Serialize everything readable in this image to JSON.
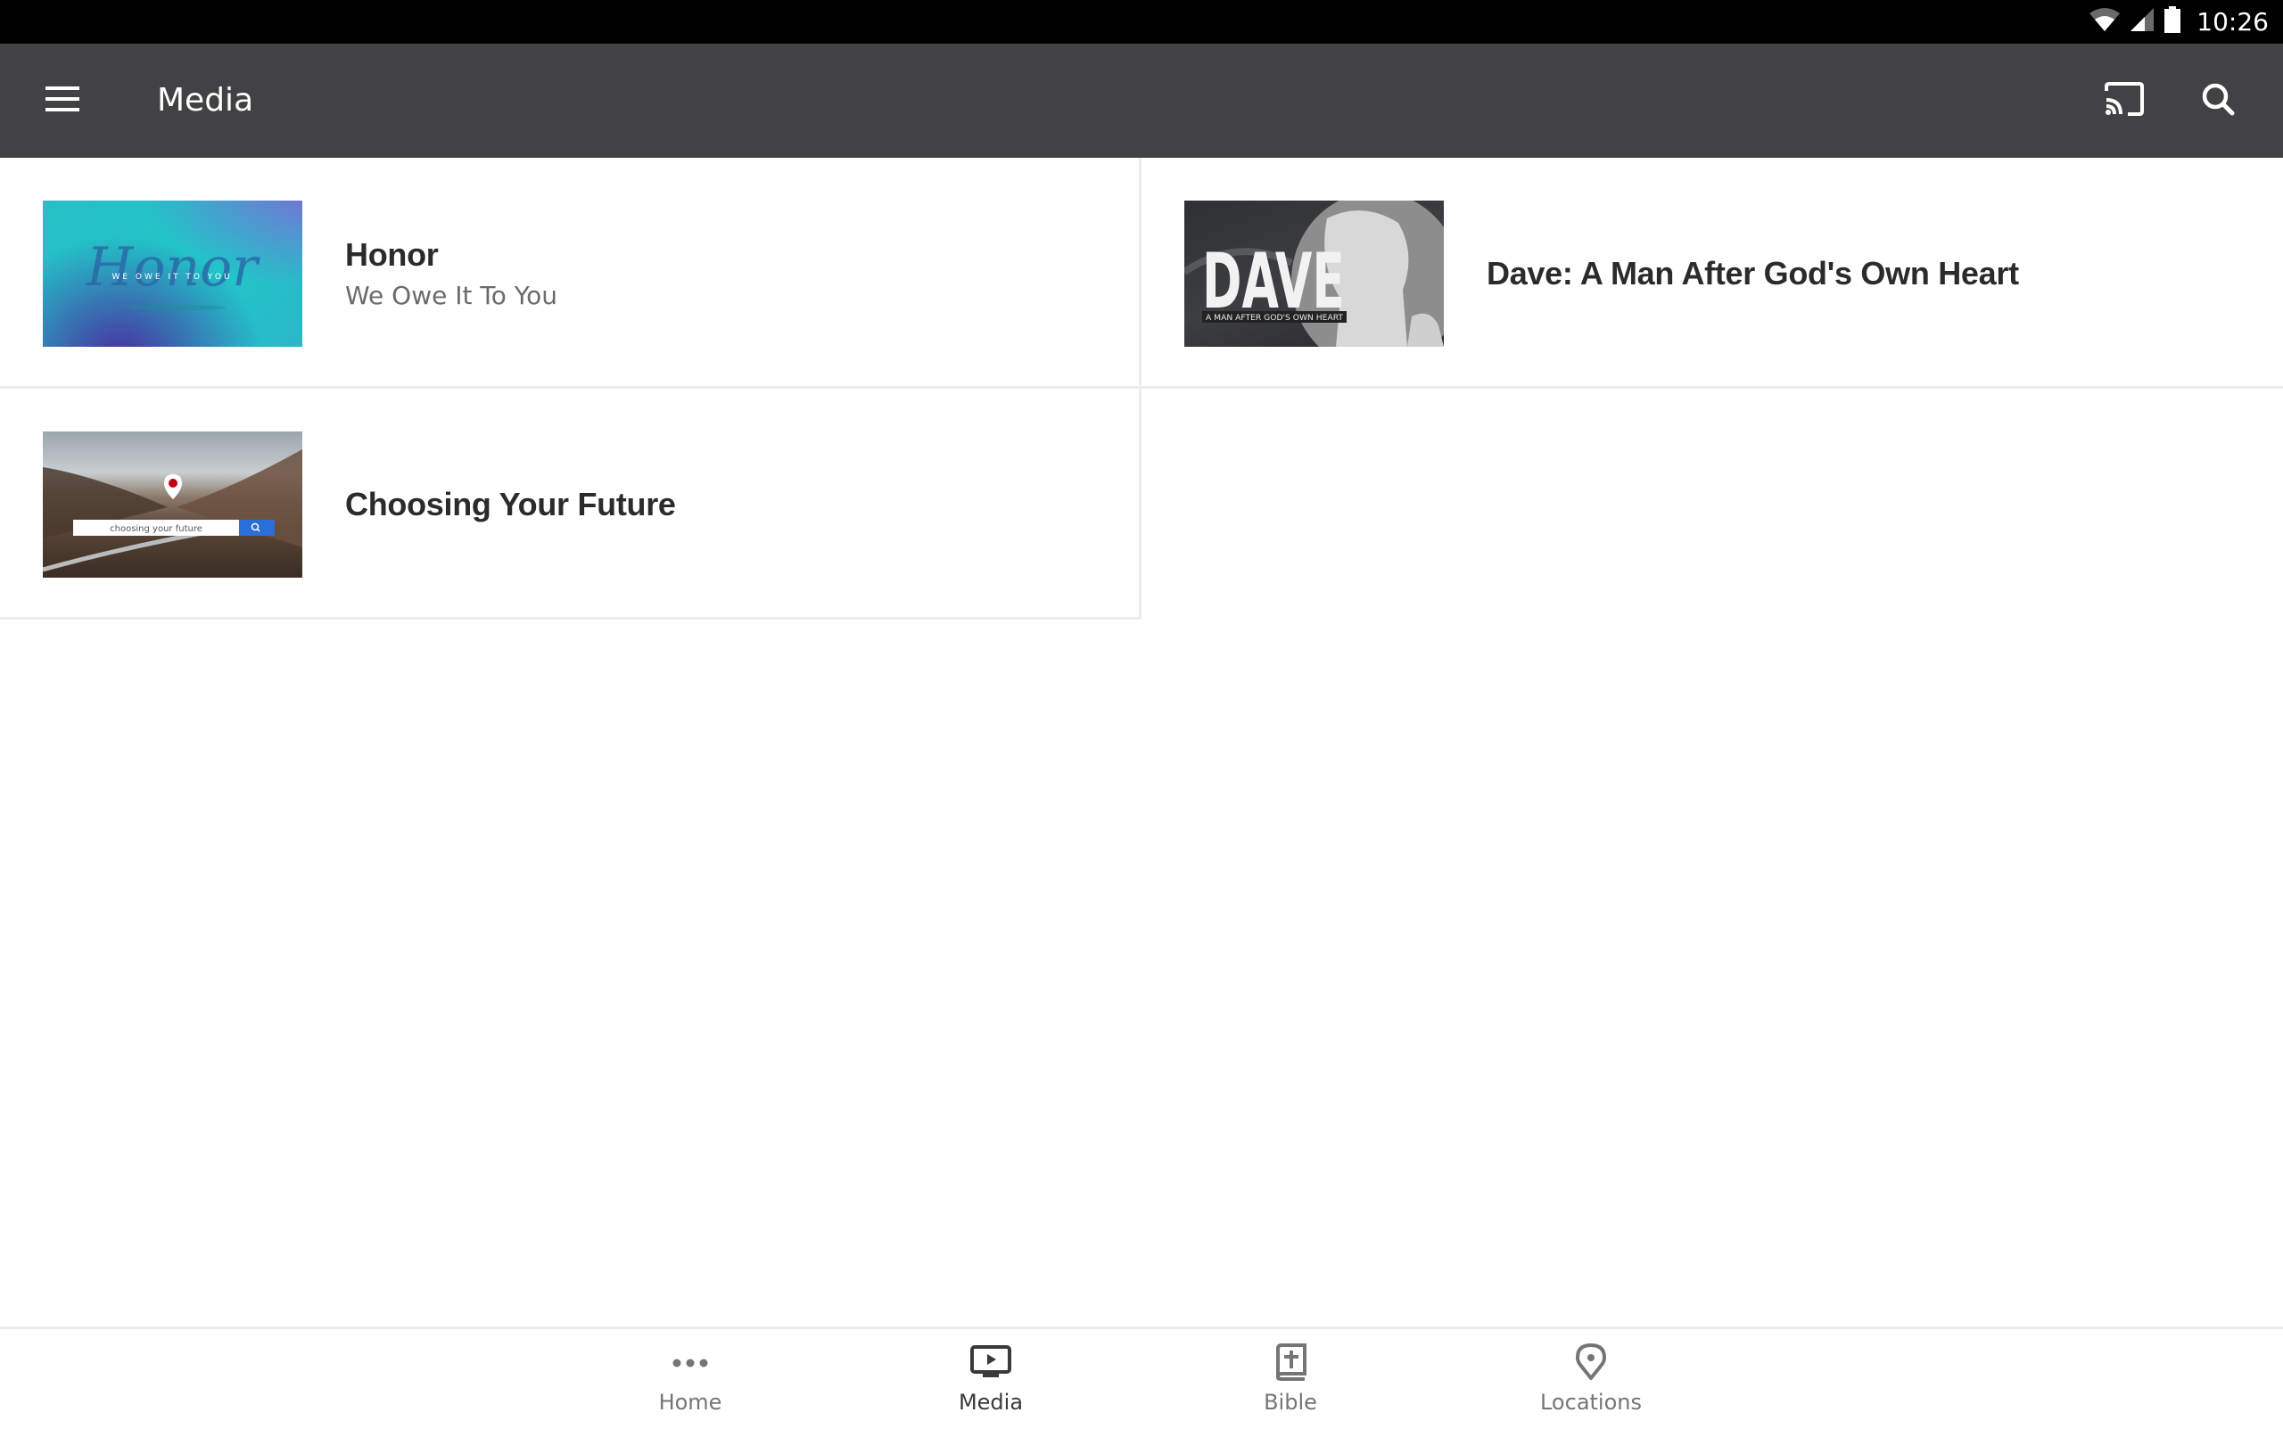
{
  "status_bar": {
    "time": "10:26",
    "icons": [
      "wifi-icon",
      "cellular-signal-icon",
      "battery-icon"
    ]
  },
  "toolbar": {
    "title": "Media",
    "menu_icon": "hamburger-menu-icon",
    "cast_icon": "cast-icon",
    "search_icon": "search-icon"
  },
  "media_items": [
    {
      "title": "Honor",
      "subtitle": "We Owe It To You",
      "thumbnail": {
        "script_text": "Honor",
        "caption": "WE OWE IT TO YOU",
        "colors": [
          "#22c4c8",
          "#4a2a9c",
          "#7a6ad0"
        ]
      }
    },
    {
      "title": "Dave: A Man After God's Own Heart",
      "subtitle": "",
      "thumbnail": {
        "big_text": "DAVE",
        "caption": "A MAN AFTER GOD'S OWN HEART"
      }
    },
    {
      "title": "Choosing Your Future",
      "subtitle": "",
      "thumbnail": {
        "search_text": "choosing your future",
        "accent": "#2a6fd8",
        "pin_color": "#c00010"
      }
    }
  ],
  "bottom_nav": {
    "items": [
      {
        "label": "Home",
        "icon": "more-dots-icon",
        "active": false
      },
      {
        "label": "Media",
        "icon": "tv-play-icon",
        "active": true
      },
      {
        "label": "Bible",
        "icon": "bible-icon",
        "active": false
      },
      {
        "label": "Locations",
        "icon": "location-pin-icon",
        "active": false
      }
    ]
  },
  "colors": {
    "toolbar": "#424244",
    "status_bar": "#000000",
    "active_nav": "#3a3a3a",
    "inactive_nav": "#757575"
  }
}
